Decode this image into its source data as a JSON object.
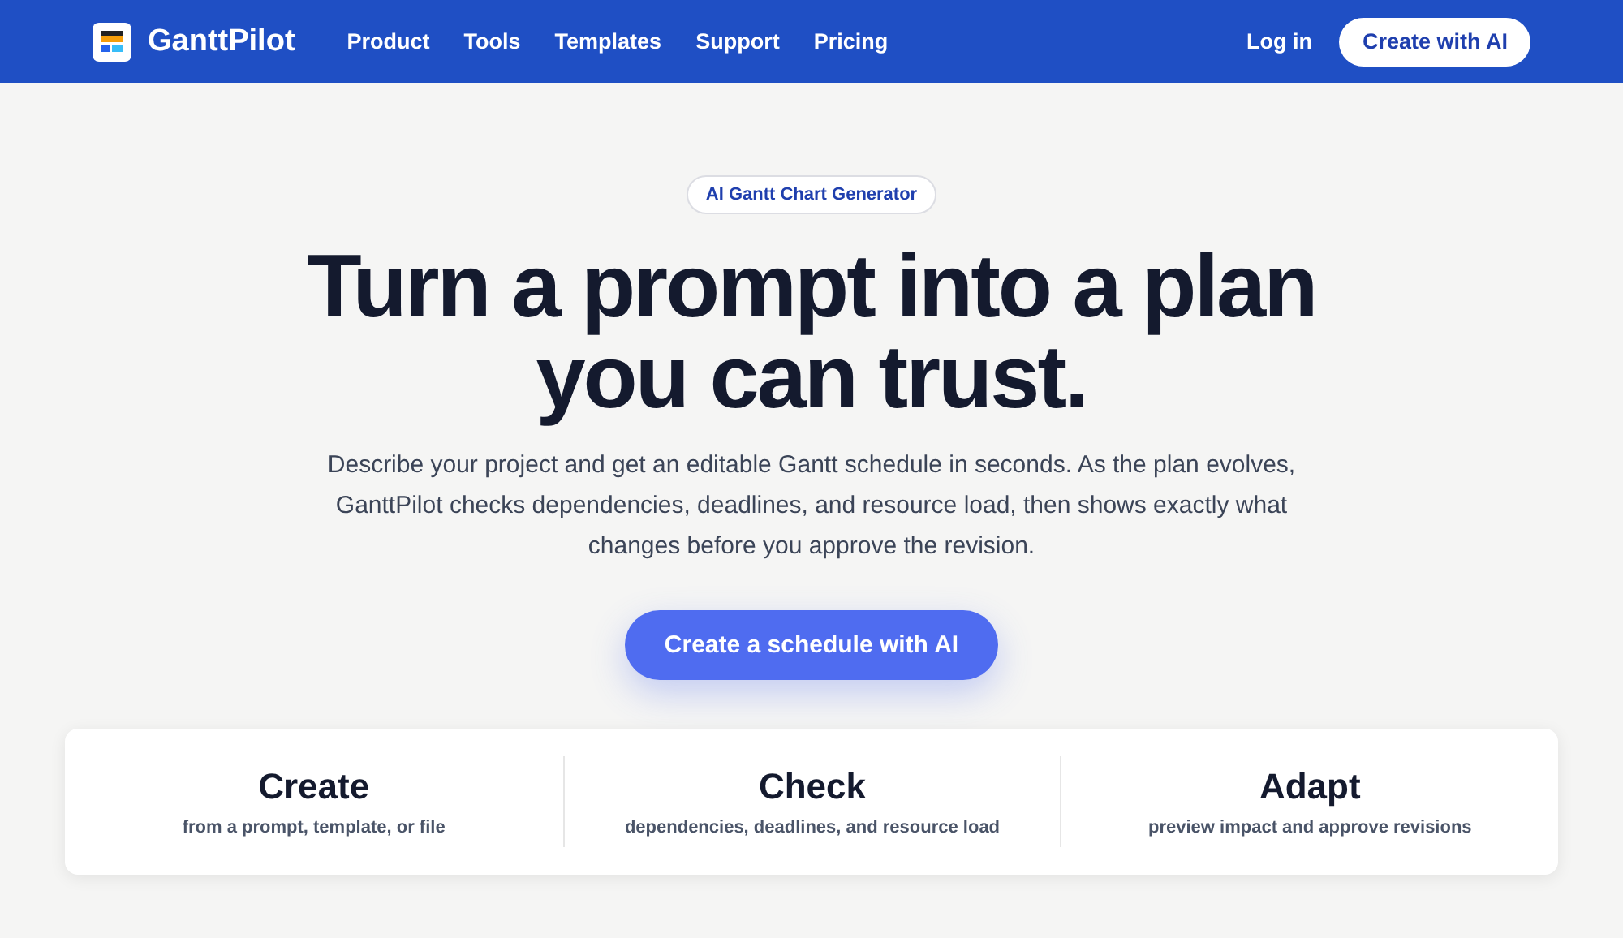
{
  "nav": {
    "brand": "GanttPilot",
    "links": [
      "Product",
      "Tools",
      "Templates",
      "Support",
      "Pricing"
    ],
    "login": "Log in",
    "cta": "Create with AI"
  },
  "hero": {
    "badge": "AI Gantt Chart Generator",
    "title": "Turn a prompt into a plan you can trust.",
    "description": "Describe your project and get an editable Gantt schedule in seconds. As the plan evolves, GanttPilot checks dependencies, deadlines, and resource load, then shows exactly what changes before you approve the revision.",
    "button": "Create a schedule with AI"
  },
  "features": [
    {
      "title": "Create",
      "subtitle": "from a prompt, template, or file"
    },
    {
      "title": "Check",
      "subtitle": "dependencies, deadlines, and resource load"
    },
    {
      "title": "Adapt",
      "subtitle": "preview impact and approve revisions"
    }
  ]
}
